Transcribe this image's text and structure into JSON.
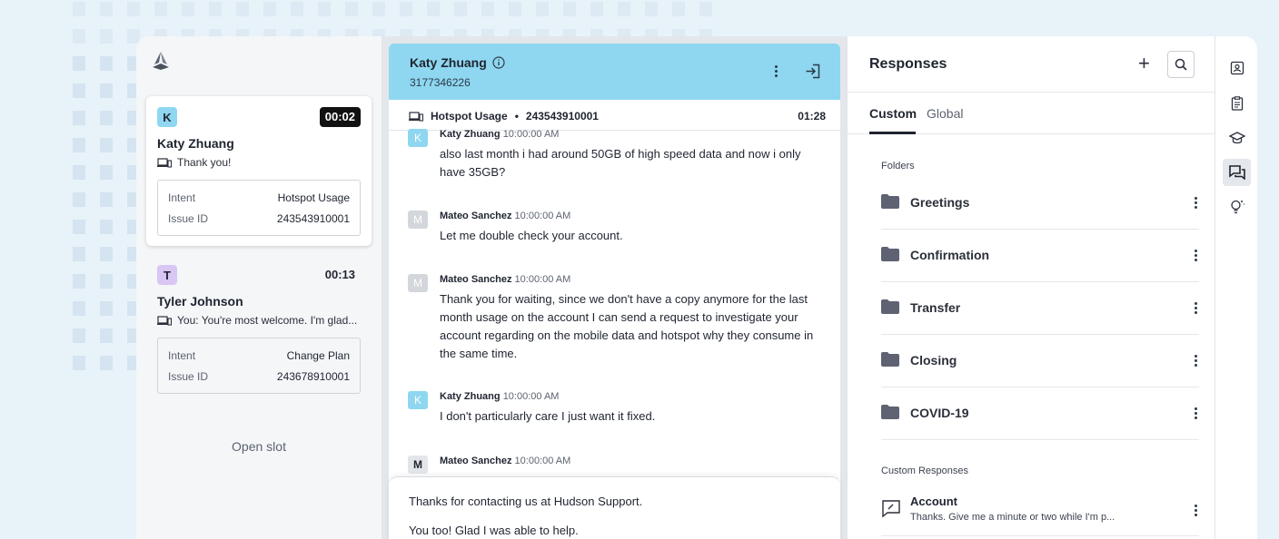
{
  "queue": {
    "conversations": [
      {
        "avatar": "K",
        "avatar_color": "#8fd7f0",
        "timer": "00:02",
        "name": "Katy Zhuang",
        "last_message": "Thank you!",
        "intent_label": "Intent",
        "intent_value": "Hotspot Usage",
        "issue_label": "Issue ID",
        "issue_value": "243543910001"
      },
      {
        "avatar": "T",
        "avatar_color": "#d9c6f5",
        "timer": "00:13",
        "name": "Tyler Johnson",
        "last_message": "You: You're most welcome. I'm glad...",
        "intent_label": "Intent",
        "intent_value": "Change Plan",
        "issue_label": "Issue ID",
        "issue_value": "243678910001"
      }
    ],
    "open_slot": "Open slot"
  },
  "chat": {
    "customer_name": "Katy Zhuang",
    "customer_phone": "3177346226",
    "header_color": "#8fd7f0",
    "issue_topic": "Hotspot Usage",
    "issue_separator": "•",
    "issue_id": "243543910001",
    "issue_timer": "01:28",
    "messages": [
      {
        "avatar": "K",
        "author": "Katy Zhuang",
        "time": "10:00:00 AM",
        "text": "also last month i had around 50GB of high speed data and now i only have 35GB?"
      },
      {
        "avatar": "M",
        "author": "Mateo Sanchez",
        "time": "10:00:00 AM",
        "text": "Let me double check your account."
      },
      {
        "avatar": "M",
        "author": "Mateo Sanchez",
        "time": "10:00:00 AM",
        "text": "Thank you for waiting,  since we don't have a copy anymore for the last month usage on the account I can send a request to investigate your account regarding on the mobile data and hotspot why they consume in the same time."
      },
      {
        "avatar": "K",
        "author": "Katy Zhuang",
        "time": "10:00:00 AM",
        "text": "I don't particularly care I just want it fixed."
      },
      {
        "avatar": "M",
        "author": "Mateo Sanchez",
        "time": "10:00:00 AM",
        "text": ""
      }
    ],
    "composer_suggestions": [
      "Thanks for contacting us at Hudson Support.",
      "You too! Glad I was able to help."
    ]
  },
  "responses": {
    "title": "Responses",
    "tabs": [
      "Custom",
      "Global"
    ],
    "active_tab": "Custom",
    "folders_label": "Folders",
    "folders": [
      "Greetings",
      "Confirmation",
      "Transfer",
      "Closing",
      "COVID-19"
    ],
    "custom_label": "Custom Responses",
    "custom_responses": [
      {
        "title": "Account",
        "preview": "Thanks. Give me a minute or two while I'm p..."
      }
    ]
  },
  "rail": {
    "icons": [
      "contact-card-icon",
      "clipboard-icon",
      "graduation-cap-icon",
      "chat-bubbles-icon",
      "lightbulb-icon"
    ],
    "active": "chat-bubbles-icon"
  }
}
